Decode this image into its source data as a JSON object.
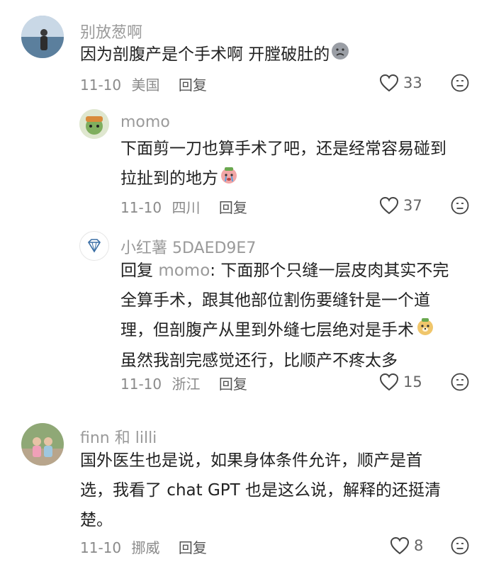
{
  "comments": [
    {
      "username": "别放葱啊",
      "text": "因为剖腹产是个手术啊 开膛破肚的",
      "date": "11-10",
      "location": "美国",
      "reply_label": "回复",
      "likes": "33",
      "emoji_icon": "sad-face-emoji"
    },
    {
      "username": "momo",
      "text_line1": "下面剪一刀也算手术了吧，还是经常容易碰到",
      "text_line2": "拉扯到的地方",
      "date": "11-10",
      "location": "四川",
      "reply_label": "回复",
      "likes": "37",
      "emoji_icon": "crying-face-emoji"
    },
    {
      "username": "小红薯 5DAED9E7",
      "reply_prefix": "回复",
      "mention": "momo",
      "text_line1": ": 下面那个只缝一层皮肉其实不完",
      "text_line2": "全算手术，跟其他部位割伤要缝针是一个道",
      "text_line3": "理，但剖腹产从里到外缝七层绝对是手术",
      "text_line4": "虽然我剖完感觉还行，比顺产不疼太多",
      "date": "11-10",
      "location": "浙江",
      "reply_label": "回复",
      "likes": "15",
      "emoji_icon": "dog-face-emoji"
    },
    {
      "username": "finn 和 lilli",
      "text_line1": "国外医生也是说，如果身体条件允许，顺产是首",
      "text_line2": "选，我看了 chat GPT 也是这么说，解释的还挺清",
      "text_line3": "楚。",
      "date": "11-10",
      "location": "挪威",
      "reply_label": "回复",
      "likes": "8"
    }
  ]
}
